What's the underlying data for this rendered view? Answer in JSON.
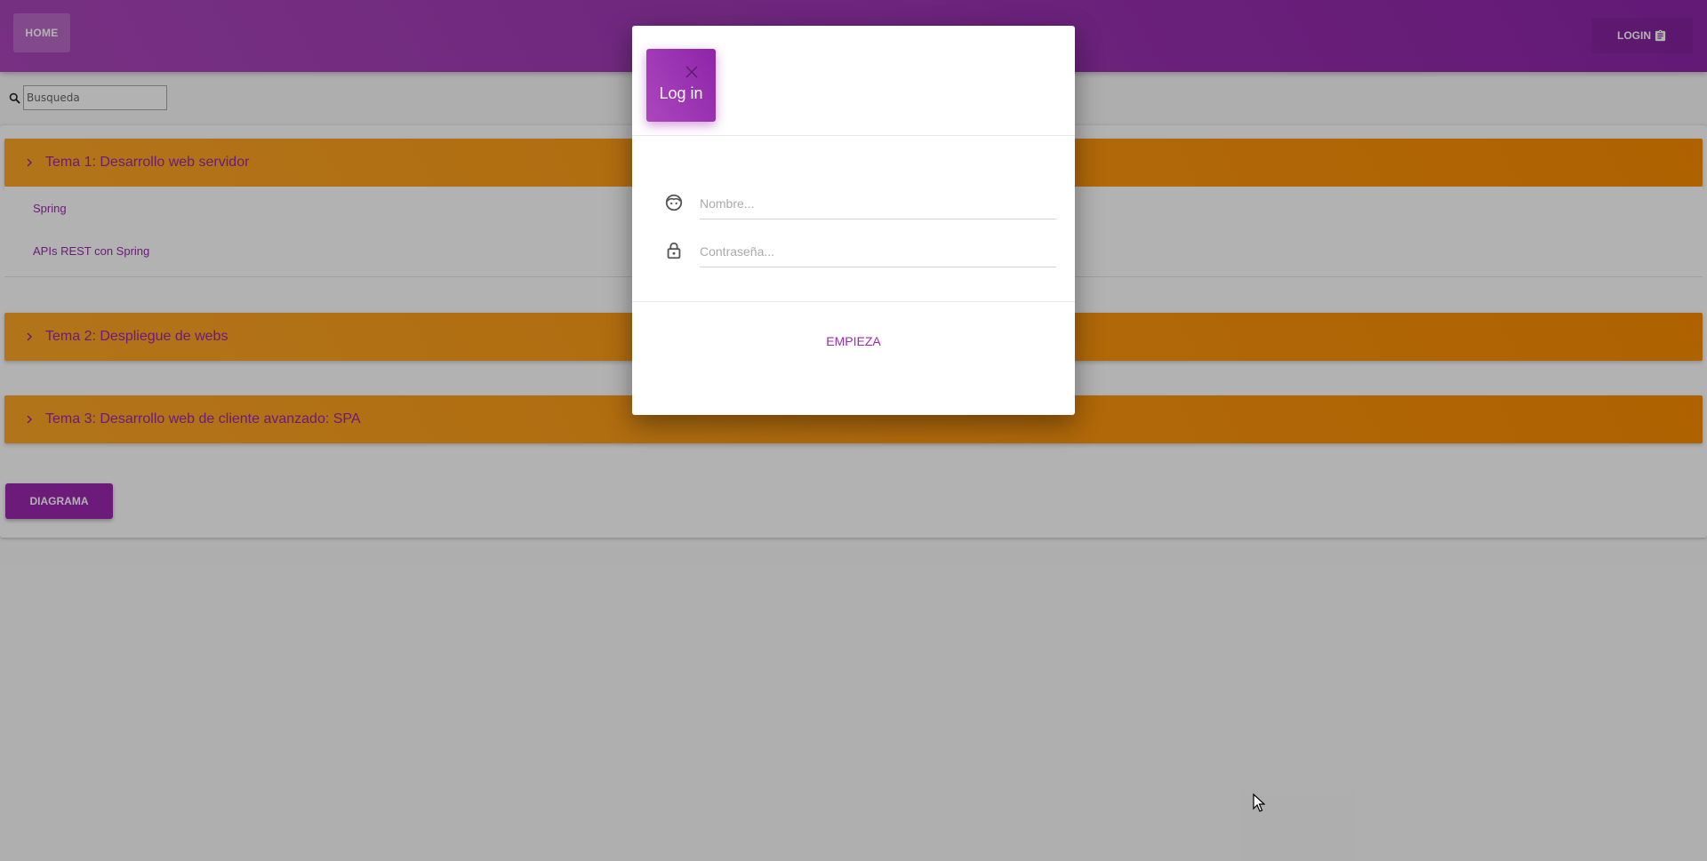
{
  "header": {
    "home_label": "HOME",
    "login_label": "LOGIN",
    "login_icon": "clipboard-icon"
  },
  "search": {
    "placeholder": "Busqueda",
    "icon": "search-icon"
  },
  "topics": [
    {
      "title": "Tema 1: Desarrollo web servidor",
      "expanded": true,
      "items": [
        "Spring",
        "APIs REST con Spring"
      ]
    },
    {
      "title": "Tema 2: Despliegue de webs",
      "expanded": false,
      "items": []
    },
    {
      "title": "Tema 3: Desarrollo web de cliente avanzado: SPA",
      "expanded": false,
      "items": []
    }
  ],
  "diagrama_label": "DIAGRAMA",
  "modal": {
    "title": "Log in",
    "close_icon": "close-icon",
    "name_placeholder": "Nombre...",
    "name_icon": "face-icon",
    "password_placeholder": "Contraseña...",
    "password_icon": "lock-icon",
    "submit_label": "EMPIEZA"
  },
  "colors": {
    "header_purple": "#9c27b0",
    "panel_orange": "#fb8c00",
    "link_purple": "#9c27b0"
  }
}
